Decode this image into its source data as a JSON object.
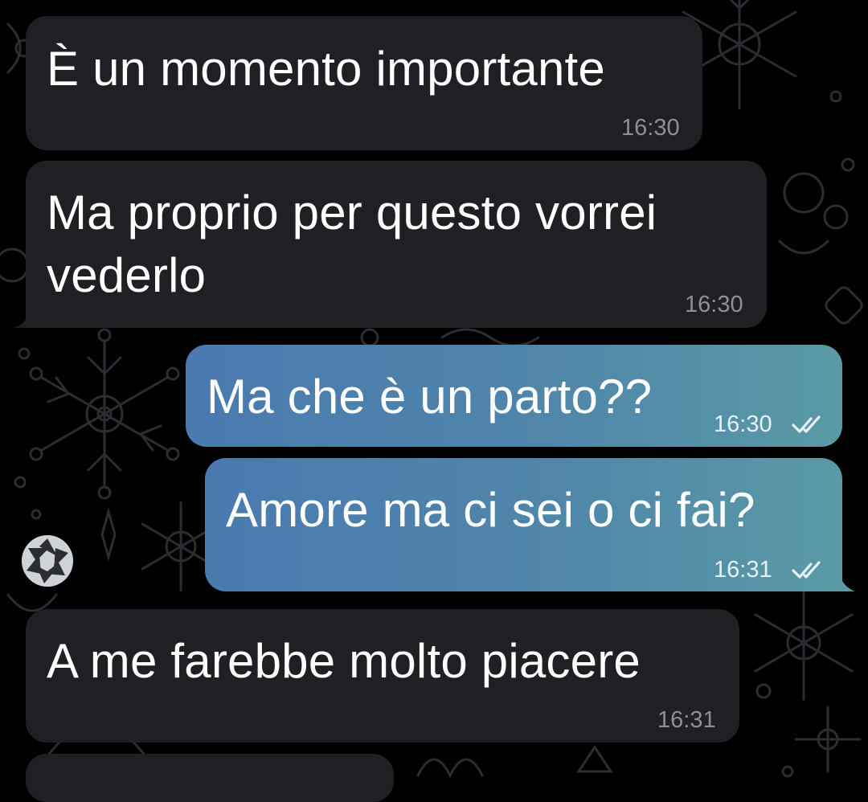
{
  "messages": [
    {
      "direction": "incoming",
      "lines": [
        "È un momento importante"
      ],
      "time": "16:30"
    },
    {
      "direction": "incoming",
      "lines": [
        "Ma proprio per questo vorrei",
        "vederlo"
      ],
      "time": "16:30"
    },
    {
      "direction": "outgoing",
      "lines": [
        "Ma che è un parto??"
      ],
      "time": "16:30",
      "status": "read"
    },
    {
      "direction": "outgoing",
      "lines": [
        "Amore ma ci sei o ci fai?"
      ],
      "time": "16:31",
      "status": "read"
    },
    {
      "direction": "incoming",
      "lines": [
        "A me farebbe molto piacere"
      ],
      "time": "16:31"
    }
  ],
  "avatar_icon": "camera-shutter-icon",
  "status_icon": "double-check-icon",
  "colors": {
    "background": "#000000",
    "incoming_bubble": "#1f2023",
    "outgoing_gradient_start": "#4a7ab0",
    "outgoing_gradient_end": "#5a9aa6",
    "message_text": "#ffffff",
    "incoming_time": "#8d9096"
  }
}
